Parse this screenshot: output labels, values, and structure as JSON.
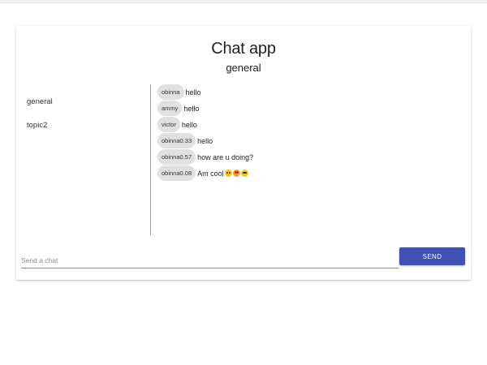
{
  "app": {
    "title": "Chat app",
    "current_topic": "general"
  },
  "topics": [
    {
      "label": "general"
    },
    {
      "label": "topic2"
    }
  ],
  "messages": [
    {
      "user": "obinna",
      "text": "hello"
    },
    {
      "user": "ammy",
      "text": "hello"
    },
    {
      "user": "victor",
      "text": "hello"
    },
    {
      "user": "obinna0.33",
      "text": "hello"
    },
    {
      "user": "obinna0.57",
      "text": "how are u doing?"
    },
    {
      "user": "obinna0.08",
      "text": "Am cool",
      "emojis": [
        "smiling-face-icon",
        "heart-eyes-face-icon",
        "sunglasses-face-icon"
      ]
    }
  ],
  "composer": {
    "placeholder": "Send a chat",
    "value": "",
    "send_label": "SEND"
  },
  "colors": {
    "accent": "#3f51b5",
    "chip": "#e0e0e0"
  }
}
